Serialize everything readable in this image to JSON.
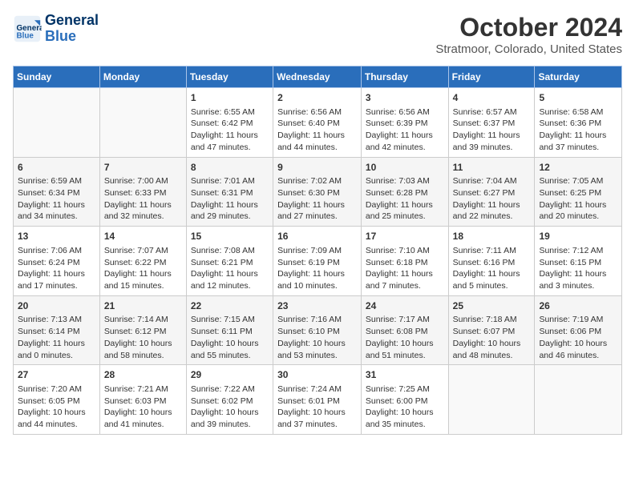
{
  "header": {
    "logo_line1": "General",
    "logo_line2": "Blue",
    "title": "October 2024",
    "subtitle": "Stratmoor, Colorado, United States"
  },
  "weekdays": [
    "Sunday",
    "Monday",
    "Tuesday",
    "Wednesday",
    "Thursday",
    "Friday",
    "Saturday"
  ],
  "weeks": [
    [
      {
        "day": "",
        "content": ""
      },
      {
        "day": "",
        "content": ""
      },
      {
        "day": "1",
        "content": "Sunrise: 6:55 AM\nSunset: 6:42 PM\nDaylight: 11 hours and 47 minutes."
      },
      {
        "day": "2",
        "content": "Sunrise: 6:56 AM\nSunset: 6:40 PM\nDaylight: 11 hours and 44 minutes."
      },
      {
        "day": "3",
        "content": "Sunrise: 6:56 AM\nSunset: 6:39 PM\nDaylight: 11 hours and 42 minutes."
      },
      {
        "day": "4",
        "content": "Sunrise: 6:57 AM\nSunset: 6:37 PM\nDaylight: 11 hours and 39 minutes."
      },
      {
        "day": "5",
        "content": "Sunrise: 6:58 AM\nSunset: 6:36 PM\nDaylight: 11 hours and 37 minutes."
      }
    ],
    [
      {
        "day": "6",
        "content": "Sunrise: 6:59 AM\nSunset: 6:34 PM\nDaylight: 11 hours and 34 minutes."
      },
      {
        "day": "7",
        "content": "Sunrise: 7:00 AM\nSunset: 6:33 PM\nDaylight: 11 hours and 32 minutes."
      },
      {
        "day": "8",
        "content": "Sunrise: 7:01 AM\nSunset: 6:31 PM\nDaylight: 11 hours and 29 minutes."
      },
      {
        "day": "9",
        "content": "Sunrise: 7:02 AM\nSunset: 6:30 PM\nDaylight: 11 hours and 27 minutes."
      },
      {
        "day": "10",
        "content": "Sunrise: 7:03 AM\nSunset: 6:28 PM\nDaylight: 11 hours and 25 minutes."
      },
      {
        "day": "11",
        "content": "Sunrise: 7:04 AM\nSunset: 6:27 PM\nDaylight: 11 hours and 22 minutes."
      },
      {
        "day": "12",
        "content": "Sunrise: 7:05 AM\nSunset: 6:25 PM\nDaylight: 11 hours and 20 minutes."
      }
    ],
    [
      {
        "day": "13",
        "content": "Sunrise: 7:06 AM\nSunset: 6:24 PM\nDaylight: 11 hours and 17 minutes."
      },
      {
        "day": "14",
        "content": "Sunrise: 7:07 AM\nSunset: 6:22 PM\nDaylight: 11 hours and 15 minutes."
      },
      {
        "day": "15",
        "content": "Sunrise: 7:08 AM\nSunset: 6:21 PM\nDaylight: 11 hours and 12 minutes."
      },
      {
        "day": "16",
        "content": "Sunrise: 7:09 AM\nSunset: 6:19 PM\nDaylight: 11 hours and 10 minutes."
      },
      {
        "day": "17",
        "content": "Sunrise: 7:10 AM\nSunset: 6:18 PM\nDaylight: 11 hours and 7 minutes."
      },
      {
        "day": "18",
        "content": "Sunrise: 7:11 AM\nSunset: 6:16 PM\nDaylight: 11 hours and 5 minutes."
      },
      {
        "day": "19",
        "content": "Sunrise: 7:12 AM\nSunset: 6:15 PM\nDaylight: 11 hours and 3 minutes."
      }
    ],
    [
      {
        "day": "20",
        "content": "Sunrise: 7:13 AM\nSunset: 6:14 PM\nDaylight: 11 hours and 0 minutes."
      },
      {
        "day": "21",
        "content": "Sunrise: 7:14 AM\nSunset: 6:12 PM\nDaylight: 10 hours and 58 minutes."
      },
      {
        "day": "22",
        "content": "Sunrise: 7:15 AM\nSunset: 6:11 PM\nDaylight: 10 hours and 55 minutes."
      },
      {
        "day": "23",
        "content": "Sunrise: 7:16 AM\nSunset: 6:10 PM\nDaylight: 10 hours and 53 minutes."
      },
      {
        "day": "24",
        "content": "Sunrise: 7:17 AM\nSunset: 6:08 PM\nDaylight: 10 hours and 51 minutes."
      },
      {
        "day": "25",
        "content": "Sunrise: 7:18 AM\nSunset: 6:07 PM\nDaylight: 10 hours and 48 minutes."
      },
      {
        "day": "26",
        "content": "Sunrise: 7:19 AM\nSunset: 6:06 PM\nDaylight: 10 hours and 46 minutes."
      }
    ],
    [
      {
        "day": "27",
        "content": "Sunrise: 7:20 AM\nSunset: 6:05 PM\nDaylight: 10 hours and 44 minutes."
      },
      {
        "day": "28",
        "content": "Sunrise: 7:21 AM\nSunset: 6:03 PM\nDaylight: 10 hours and 41 minutes."
      },
      {
        "day": "29",
        "content": "Sunrise: 7:22 AM\nSunset: 6:02 PM\nDaylight: 10 hours and 39 minutes."
      },
      {
        "day": "30",
        "content": "Sunrise: 7:24 AM\nSunset: 6:01 PM\nDaylight: 10 hours and 37 minutes."
      },
      {
        "day": "31",
        "content": "Sunrise: 7:25 AM\nSunset: 6:00 PM\nDaylight: 10 hours and 35 minutes."
      },
      {
        "day": "",
        "content": ""
      },
      {
        "day": "",
        "content": ""
      }
    ]
  ]
}
